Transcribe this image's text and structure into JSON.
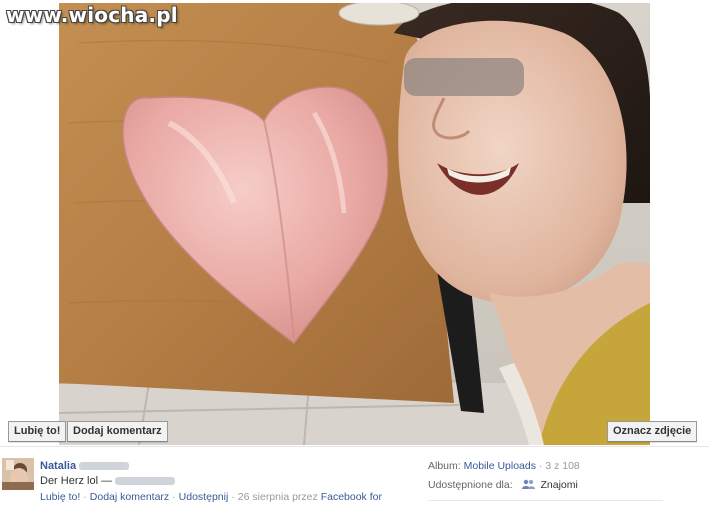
{
  "watermark": "www.wiocha.pl",
  "photo_buttons": {
    "like": "Lubię to!",
    "comment": "Dodaj komentarz",
    "tag": "Oznacz zdjęcie"
  },
  "post": {
    "owner_name": "Natalia",
    "caption": "Der Herz lol —",
    "actions": {
      "like": "Lubię to!",
      "comment": "Dodaj komentarz",
      "share": "Udostępnij",
      "separator": "·",
      "timestamp": "26 sierpnia przez",
      "source": "Facebook for"
    }
  },
  "album": {
    "label": "Album:",
    "name": "Mobile Uploads",
    "position": "· 3 z 108"
  },
  "sharing": {
    "label": "Udostępnione dla:",
    "audience": "Znajomi"
  },
  "colors": {
    "link": "#3b5998",
    "muted": "#999999",
    "button_bg": "#f2f2f2"
  },
  "icons": [
    "friends-icon"
  ]
}
